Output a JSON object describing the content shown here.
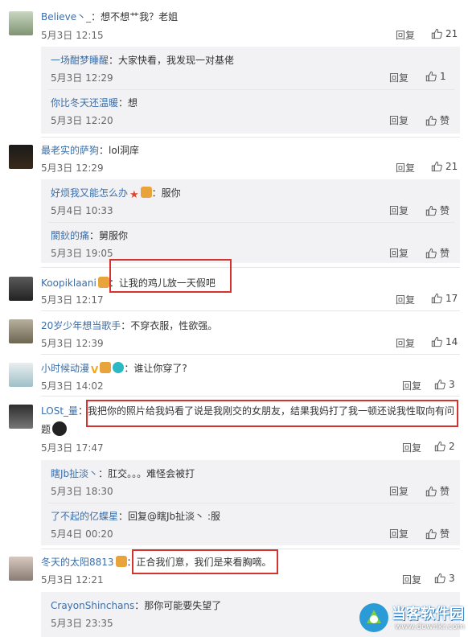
{
  "comments": [
    {
      "name": "Believe丶_",
      "text": "：想不想艹我？老姐",
      "time": "5月3日 12:15",
      "reply": "回复",
      "likes": "21"
    },
    {
      "name": "最老实的萨狗",
      "text": "：lol洞庠",
      "time": "5月3日 12:29",
      "reply": "回复",
      "likes": "21"
    },
    {
      "name": "Koopiklaani",
      "text": "：让我的鸡儿放一天假吧",
      "time": "5月3日 12:17",
      "reply": "回复",
      "likes": "17"
    },
    {
      "name": "20岁少年想当歌手",
      "text": "：不穿衣服，性欲强。",
      "time": "5月3日 12:39",
      "reply": "回复",
      "likes": "14"
    },
    {
      "name": "小时候动漫",
      "text": "：谁让你穿了?",
      "time": "5月3日 14:02",
      "reply": "回复",
      "likes": "3"
    },
    {
      "name": "LOSt_量",
      "text1": "：我把你的照片给我妈看了说是我刚交的女朋友，结果我妈打了我一顿还说我性取向有问",
      "text2": "题",
      "time": "5月3日 17:47",
      "reply": "回复",
      "likes": "2"
    },
    {
      "name": "冬天的太阳8813",
      "text": "：正合我们意，我们是来看胸嘀。",
      "time": "5月3日 12:21",
      "reply": "回复",
      "likes": "3"
    }
  ],
  "replies": [
    {
      "name": "一场酣梦睡醒",
      "text": "：大家快看，我发现一对基佬",
      "time": "5月3日 12:29",
      "reply": "回复",
      "likes": "1"
    },
    {
      "name": "你比冬天还温暖",
      "text": "：想",
      "time": "5月3日 12:20",
      "reply": "回复",
      "likes": "赞"
    },
    {
      "name": "好烦我又能怎么办",
      "text": "：服你",
      "time": "5月4日 10:33",
      "reply": "回复",
      "likes": "赞"
    },
    {
      "name": "閬鈥的痛",
      "text": "：舅服你",
      "time": "5月3日 19:05",
      "reply": "回复",
      "likes": "赞"
    },
    {
      "name": "瞎Jb扯淡丶",
      "text": "：肛交。。。难怪会被打",
      "time": "5月3日 18:30",
      "reply": "回复",
      "likes": "赞"
    },
    {
      "name": "了不起的亿蝶星",
      "text": "：回复@瞎Jb扯淡丶 :服",
      "time": "5月4日 00:20",
      "reply": "回复",
      "likes": "赞"
    },
    {
      "name": "CrayonShinchans",
      "text": "：那你可能要失望了",
      "time": "5月3日 23:35"
    }
  ],
  "watermark": {
    "title": "当客软件园",
    "url": "www.downkr.com"
  },
  "colors": {
    "link": "#3b6ea8",
    "highlight": "#d6332f",
    "subbox": "#f2f2f5"
  }
}
